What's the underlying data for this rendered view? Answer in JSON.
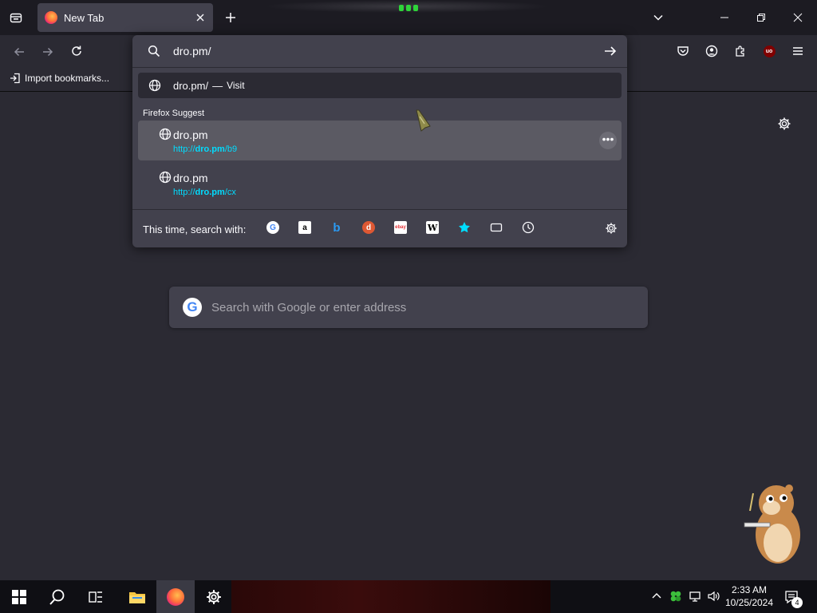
{
  "tab": {
    "title": "New Tab"
  },
  "bookmarks": {
    "import_label": "Import bookmarks..."
  },
  "urlbar": {
    "value": "dro.pm/",
    "visit_row": {
      "url": "dro.pm/",
      "separator": "—",
      "label": "Visit"
    },
    "suggest_heading": "Firefox Suggest",
    "suggestions": [
      {
        "title": "dro.pm",
        "url_prefix": "http://",
        "url_bold": "dro.pm",
        "url_suffix": "/b9",
        "selected": true
      },
      {
        "title": "dro.pm",
        "url_prefix": "http://",
        "url_bold": "dro.pm",
        "url_suffix": "/cx",
        "selected": false
      }
    ],
    "search_with_label": "This time, search with:",
    "engines": [
      "google-icon",
      "amazon-icon",
      "bing-icon",
      "duckduckgo-icon",
      "ebay-icon",
      "wikipedia-icon",
      "bookmarks-star-icon",
      "tabs-icon",
      "history-icon"
    ]
  },
  "newtab": {
    "search_placeholder": "Search with Google or enter address"
  },
  "taskbar": {
    "time": "2:33 AM",
    "date": "10/25/2024",
    "notification_count": "4"
  },
  "colors": {
    "frame": "#1c1b22",
    "toolbar": "#2b2a33",
    "panel": "#42414d",
    "selected_row": "#5b5a63",
    "link": "#00ddff"
  }
}
